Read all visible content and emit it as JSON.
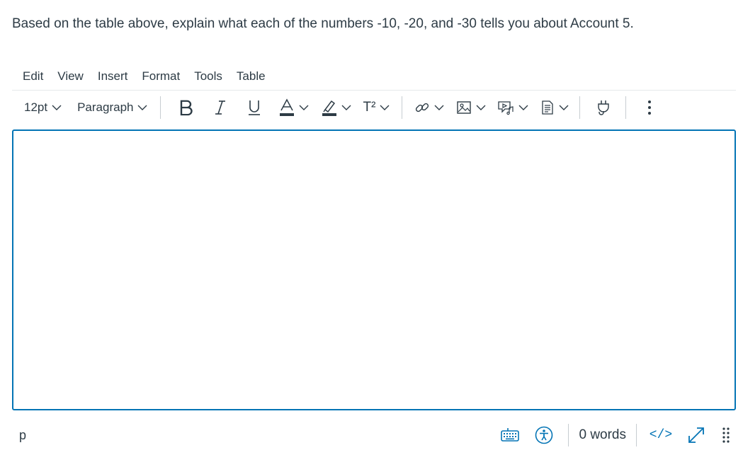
{
  "question": {
    "text": "Based on the table above, explain what each of the numbers -10, -20, and -30 tells you about Account 5."
  },
  "menubar": {
    "items": [
      "Edit",
      "View",
      "Insert",
      "Format",
      "Tools",
      "Table"
    ]
  },
  "toolbar": {
    "font_size": "12pt",
    "block_format": "Paragraph",
    "superscript_label": "T²"
  },
  "editor": {
    "content": ""
  },
  "statusbar": {
    "path": "p",
    "word_count": "0 words",
    "html_editor_label": "</>"
  },
  "colors": {
    "accent": "#0374b5",
    "text": "#2d3b45",
    "separator": "#c7cdd1"
  }
}
